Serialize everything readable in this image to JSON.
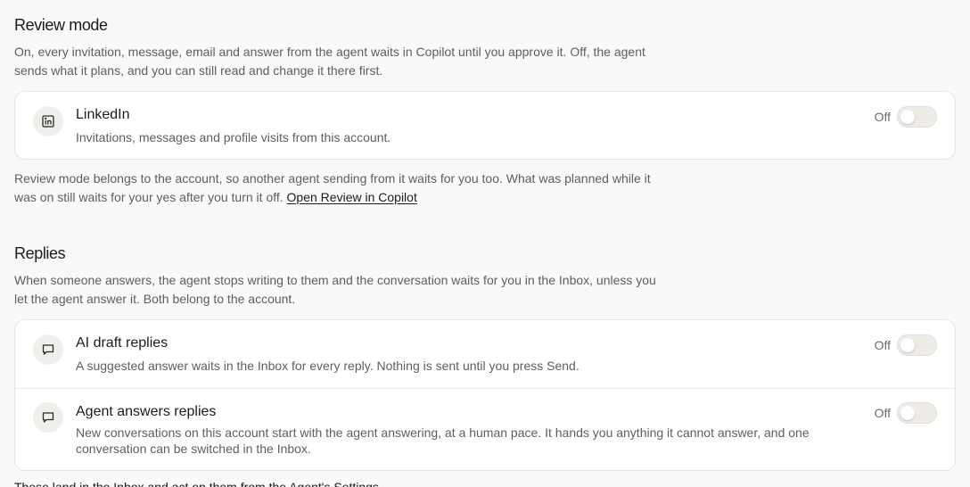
{
  "review": {
    "title": "Review mode",
    "description": "On, every invitation, message, email and answer from the agent waits in Copilot until you approve it. Off, the agent sends what it plans, and you can still read and change it there first.",
    "items": [
      {
        "title": "LinkedIn",
        "description": "Invitations, messages and profile visits from this account.",
        "state_label": "Off",
        "enabled": false,
        "icon": "linkedin-icon"
      }
    ],
    "note": "Review mode belongs to the account, so another agent sending from it waits for you too. What was planned while it was on still waits for your yes after you turn it off.",
    "note_link": "Open Review in Copilot"
  },
  "replies": {
    "title": "Replies",
    "description": "When someone answers, the agent stops writing to them and the conversation waits for you in the Inbox, unless you let the agent answer it. Both belong to the account.",
    "items": [
      {
        "title": "AI draft replies",
        "description": "A suggested answer waits in the Inbox for every reply. Nothing is sent until you press Send.",
        "state_label": "Off",
        "enabled": false,
        "icon": "chat-bubble-icon"
      },
      {
        "title": "Agent answers replies",
        "description": "New conversations on this account start with the agent answering, at a human pace. It hands you anything it cannot answer, and one conversation can be switched in the Inbox.",
        "state_label": "Off",
        "enabled": false,
        "icon": "chat-bubble-icon"
      }
    ]
  },
  "footer_partial": "These land in the Inbox and act on them from the Agent's Settings"
}
